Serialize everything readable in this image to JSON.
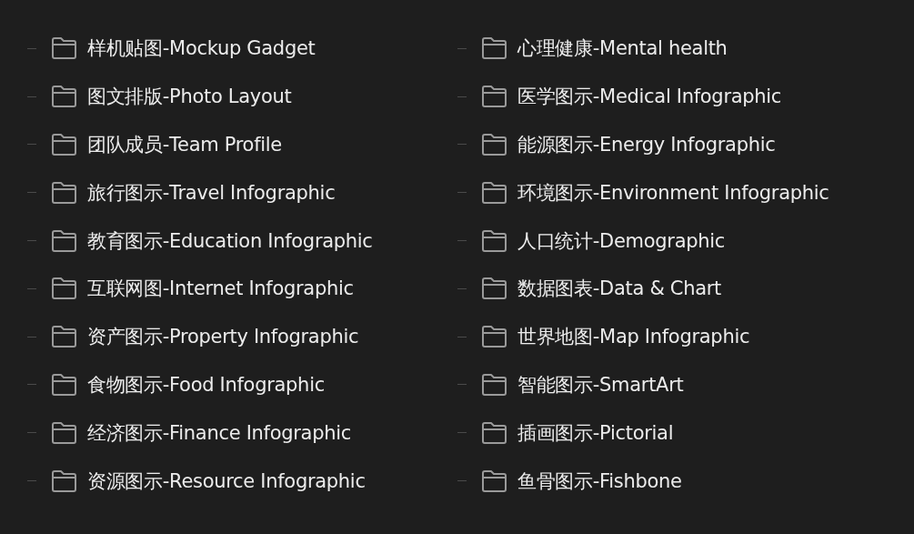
{
  "columns": [
    {
      "items": [
        {
          "label": "样机贴图-Mockup Gadget"
        },
        {
          "label": "图文排版-Photo Layout"
        },
        {
          "label": "团队成员-Team Profile"
        },
        {
          "label": "旅行图示-Travel Infographic"
        },
        {
          "label": "教育图示-Education Infographic"
        },
        {
          "label": "互联网图-Internet Infographic"
        },
        {
          "label": "资产图示-Property Infographic"
        },
        {
          "label": "食物图示-Food Infographic"
        },
        {
          "label": "经济图示-Finance Infographic"
        },
        {
          "label": "资源图示-Resource Infographic"
        }
      ]
    },
    {
      "items": [
        {
          "label": "心理健康-Mental health"
        },
        {
          "label": "医学图示-Medical Infographic"
        },
        {
          "label": "能源图示-Energy Infographic"
        },
        {
          "label": "环境图示-Environment Infographic"
        },
        {
          "label": "人口统计-Demographic"
        },
        {
          "label": "数据图表-Data & Chart"
        },
        {
          "label": "世界地图-Map Infographic"
        },
        {
          "label": "智能图示-SmartArt"
        },
        {
          "label": "插画图示-Pictorial"
        },
        {
          "label": "鱼骨图示-Fishbone"
        }
      ]
    }
  ]
}
